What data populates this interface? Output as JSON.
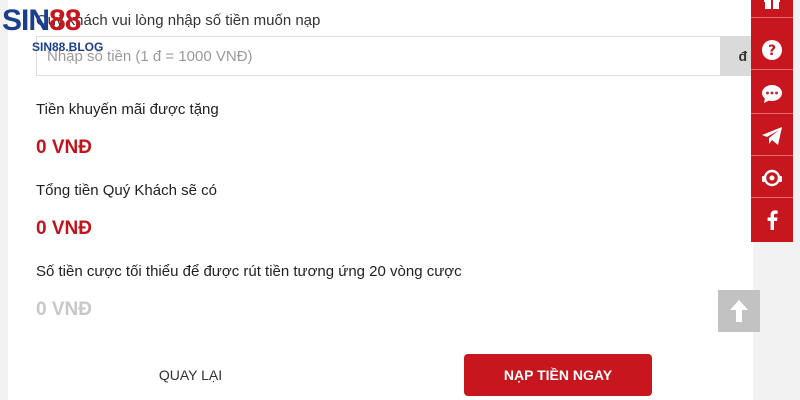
{
  "logo": {
    "brand_main": "SIN",
    "brand_accent": "88",
    "site": "SIN88.BLOG"
  },
  "form": {
    "amount_label": "Quý khách vui lòng nhập số tiền muốn nạp",
    "amount_placeholder": "Nhập số tiền (1 đ = 1000 VNĐ)",
    "currency_suffix": "đ"
  },
  "summary": {
    "bonus_label": "Tiền khuyến mãi được tặng",
    "bonus_value": "0 VNĐ",
    "total_label": "Tổng tiền Quý Khách sẽ có",
    "total_value": "0 VNĐ",
    "min_bet_label": "Số tiền cược tối thiểu để được rút tiền tương ứng 20 vòng cược",
    "min_bet_value": "0 VNĐ"
  },
  "actions": {
    "back_label": "QUAY LẠI",
    "deposit_label": "NẠP TIỀN NGAY"
  },
  "sidebar": {
    "icons": [
      "gift-icon",
      "help-icon",
      "chat-icon",
      "telegram-icon",
      "support-icon",
      "facebook-icon"
    ]
  },
  "colors": {
    "brand_red": "#c8161e",
    "value_red": "#c0151d",
    "brand_blue": "#1a3f8f"
  }
}
